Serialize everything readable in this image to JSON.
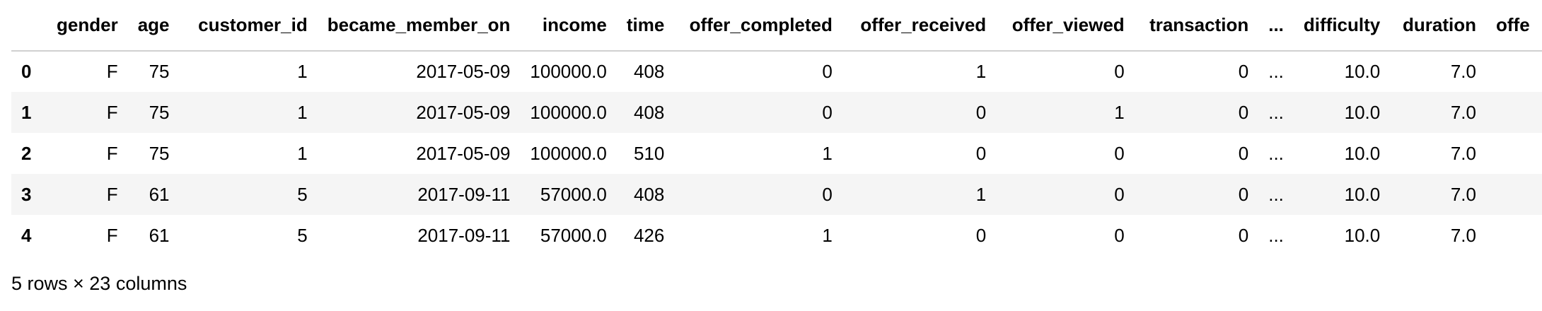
{
  "dataframe": {
    "index_header": "",
    "columns": [
      "gender",
      "age",
      "customer_id",
      "became_member_on",
      "income",
      "time",
      "offer_completed",
      "offer_received",
      "offer_viewed",
      "transaction",
      "...",
      "difficulty",
      "duration",
      "offe"
    ],
    "rows": [
      {
        "index": "0",
        "cells": [
          "F",
          "75",
          "1",
          "2017-05-09",
          "100000.0",
          "408",
          "0",
          "1",
          "0",
          "0",
          "...",
          "10.0",
          "7.0",
          ""
        ]
      },
      {
        "index": "1",
        "cells": [
          "F",
          "75",
          "1",
          "2017-05-09",
          "100000.0",
          "408",
          "0",
          "0",
          "1",
          "0",
          "...",
          "10.0",
          "7.0",
          ""
        ]
      },
      {
        "index": "2",
        "cells": [
          "F",
          "75",
          "1",
          "2017-05-09",
          "100000.0",
          "510",
          "1",
          "0",
          "0",
          "0",
          "...",
          "10.0",
          "7.0",
          ""
        ]
      },
      {
        "index": "3",
        "cells": [
          "F",
          "61",
          "5",
          "2017-09-11",
          "57000.0",
          "408",
          "0",
          "1",
          "0",
          "0",
          "...",
          "10.0",
          "7.0",
          ""
        ]
      },
      {
        "index": "4",
        "cells": [
          "F",
          "61",
          "5",
          "2017-09-11",
          "57000.0",
          "426",
          "1",
          "0",
          "0",
          "0",
          "...",
          "10.0",
          "7.0",
          ""
        ]
      }
    ]
  },
  "footer": {
    "shape_text": "5 rows × 23 columns"
  }
}
